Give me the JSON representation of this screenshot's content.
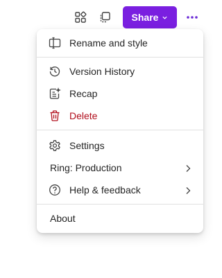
{
  "toolbar": {
    "apps_icon": "apps-grid-icon",
    "copy_icon": "copy-icon",
    "share_label": "Share",
    "more_icon": "more-horizontal-icon",
    "accent_color": "#7a1fe0"
  },
  "menu": {
    "groups": [
      [
        {
          "label": "Rename and style",
          "icon": "rename-panel-icon"
        }
      ],
      [
        {
          "label": "Version History",
          "icon": "history-icon"
        },
        {
          "label": "Recap",
          "icon": "recap-sparkle-icon"
        },
        {
          "label": "Delete",
          "icon": "trash-icon",
          "danger": true
        }
      ],
      [
        {
          "label": "Settings",
          "icon": "gear-icon"
        },
        {
          "label": "Ring: Production",
          "submenu": true
        },
        {
          "label": "Help & feedback",
          "icon": "help-icon",
          "submenu": true
        }
      ],
      [
        {
          "label": "About"
        }
      ]
    ],
    "danger_color": "#b10e1c"
  }
}
